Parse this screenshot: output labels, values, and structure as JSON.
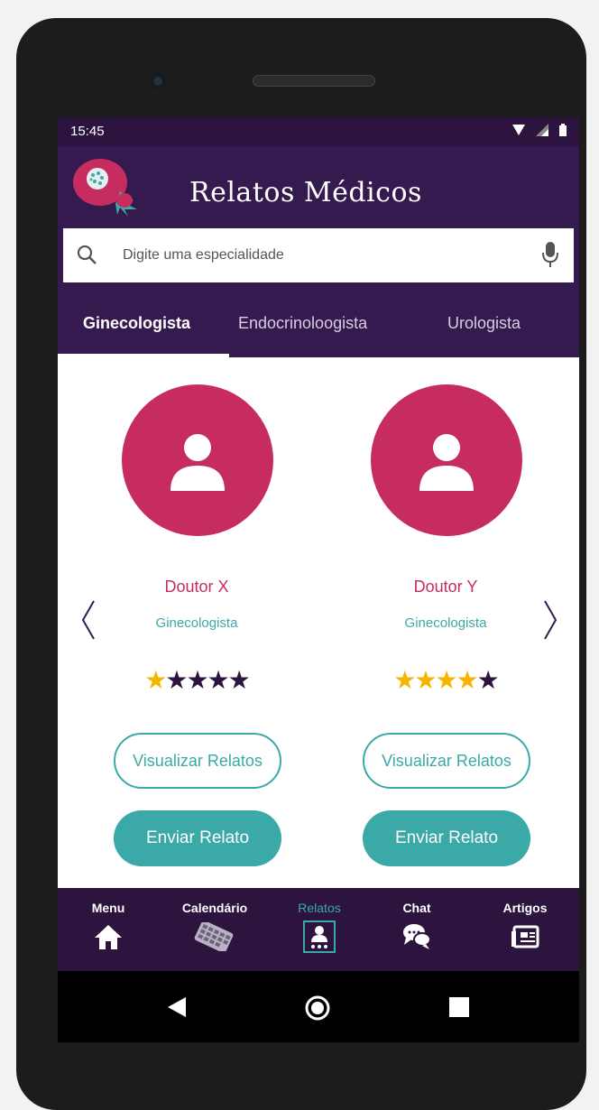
{
  "status": {
    "time": "15:45"
  },
  "app": {
    "title": "Relatos Médicos"
  },
  "search": {
    "placeholder": "Digite uma especialidade"
  },
  "tabs": [
    {
      "label": "Ginecologista",
      "active": true
    },
    {
      "label": "Endocrinoloogista",
      "active": false
    },
    {
      "label": "Urologista",
      "active": false
    }
  ],
  "doctors": [
    {
      "name": "Doutor X",
      "specialty": "Ginecologista",
      "rating": 1,
      "view_label": "Visualizar Relatos",
      "send_label": "Enviar Relato"
    },
    {
      "name": "Doutor Y",
      "specialty": "Ginecologista",
      "rating": 4,
      "view_label": "Visualizar Relatos",
      "send_label": "Enviar Relato"
    }
  ],
  "rating_max": 5,
  "bottom_nav": [
    {
      "label": "Menu",
      "icon": "home-icon"
    },
    {
      "label": "Calendário",
      "icon": "calendar-icon"
    },
    {
      "label": "Relatos",
      "icon": "reports-icon",
      "active": true
    },
    {
      "label": "Chat",
      "icon": "chat-icon"
    },
    {
      "label": "Artigos",
      "icon": "articles-icon"
    }
  ],
  "colors": {
    "primary": "#351a4f",
    "accent": "#c72c5f",
    "teal": "#3aa9a8",
    "star": "#f4b400"
  }
}
